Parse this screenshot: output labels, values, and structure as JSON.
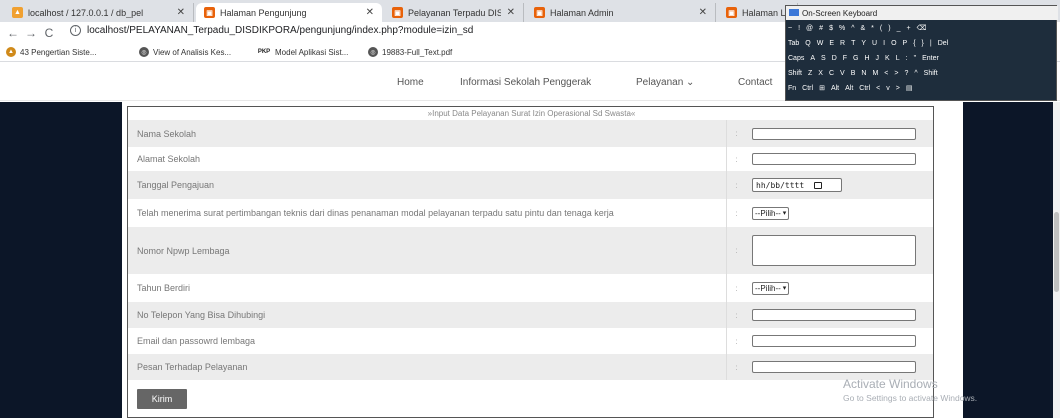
{
  "browser": {
    "tabs": [
      {
        "label": "localhost / 127.0.0.1 / db_pel",
        "icon": "phpmyadmin-icon"
      },
      {
        "label": "Halaman Pengunjung",
        "icon": "app-icon"
      },
      {
        "label": "Pelayanan Terpadu DISDIKPO",
        "icon": "app-icon"
      },
      {
        "label": "Halaman Admin",
        "icon": "app-icon"
      },
      {
        "label": "Halaman Login A",
        "icon": "app-icon"
      }
    ],
    "url": "localhost/PELAYANAN_Terpadu_DISDIKPORA/pengunjung/index.php?module=izin_sd",
    "bookmarks": [
      {
        "label": "43 Pengertian Siste...",
        "icon": "bookmark-site-icon"
      },
      {
        "label": "View of Analisis Kes...",
        "icon": "globe-icon"
      },
      {
        "label": "Model Aplikasi Sist...",
        "icon": "pdf-icon",
        "prefix": "PKP"
      },
      {
        "label": "19883-Full_Text.pdf",
        "icon": "globe-icon"
      }
    ]
  },
  "nav": {
    "links": [
      "Home",
      "Informasi Sekolah Penggerak",
      "Pelayanan",
      "Contact"
    ]
  },
  "form": {
    "title": "»Input Data Pelayanan Surat Izin Operasional Sd Swasta«",
    "colon": ":",
    "rows": [
      {
        "label": "Nama Sekolah",
        "type": "text"
      },
      {
        "label": "Alamat Sekolah",
        "type": "text"
      },
      {
        "label": "Tanggal Pengajuan",
        "type": "date",
        "value": "hh/bb/tttt"
      },
      {
        "label": "Telah menerima surat pertimbangan teknis dari dinas penanaman modal pelayanan terpadu satu pintu dan tenaga kerja",
        "type": "select",
        "value": "--Pilih--"
      },
      {
        "label": "Nomor Npwp Lembaga",
        "type": "textarea"
      },
      {
        "label": "Tahun Berdiri",
        "type": "select",
        "value": "--Pilih--"
      },
      {
        "label": "No Telepon Yang Bisa Dihubingi",
        "type": "text"
      },
      {
        "label": "Email dan passowrd lembaga",
        "type": "text"
      },
      {
        "label": "Pesan Terhadap Pelayanan",
        "type": "text"
      }
    ],
    "submit_label": "Kirim"
  },
  "osk": {
    "title": "On-Screen Keyboard",
    "rows": [
      [
        "~",
        "!",
        "@",
        "#",
        "$",
        "%",
        "^",
        "&",
        "*",
        "(",
        ")",
        "_",
        "+",
        "⌫"
      ],
      [
        "Tab",
        "Q",
        "W",
        "E",
        "R",
        "T",
        "Y",
        "U",
        "I",
        "O",
        "P",
        "{",
        "}",
        "|",
        "Del"
      ],
      [
        "Caps",
        "A",
        "S",
        "D",
        "F",
        "G",
        "H",
        "J",
        "K",
        "L",
        ":",
        "\"",
        "Enter"
      ],
      [
        "Shift",
        "Z",
        "X",
        "C",
        "V",
        "B",
        "N",
        "M",
        "<",
        ">",
        "?",
        "^",
        "Shift"
      ],
      [
        "Fn",
        "Ctrl",
        "⊞",
        "Alt",
        "Alt",
        "Ctrl",
        "<",
        "v",
        ">",
        "▤"
      ]
    ]
  },
  "watermark": {
    "line1": "Activate Windows",
    "line2": "Go to Settings to activate Windows."
  }
}
